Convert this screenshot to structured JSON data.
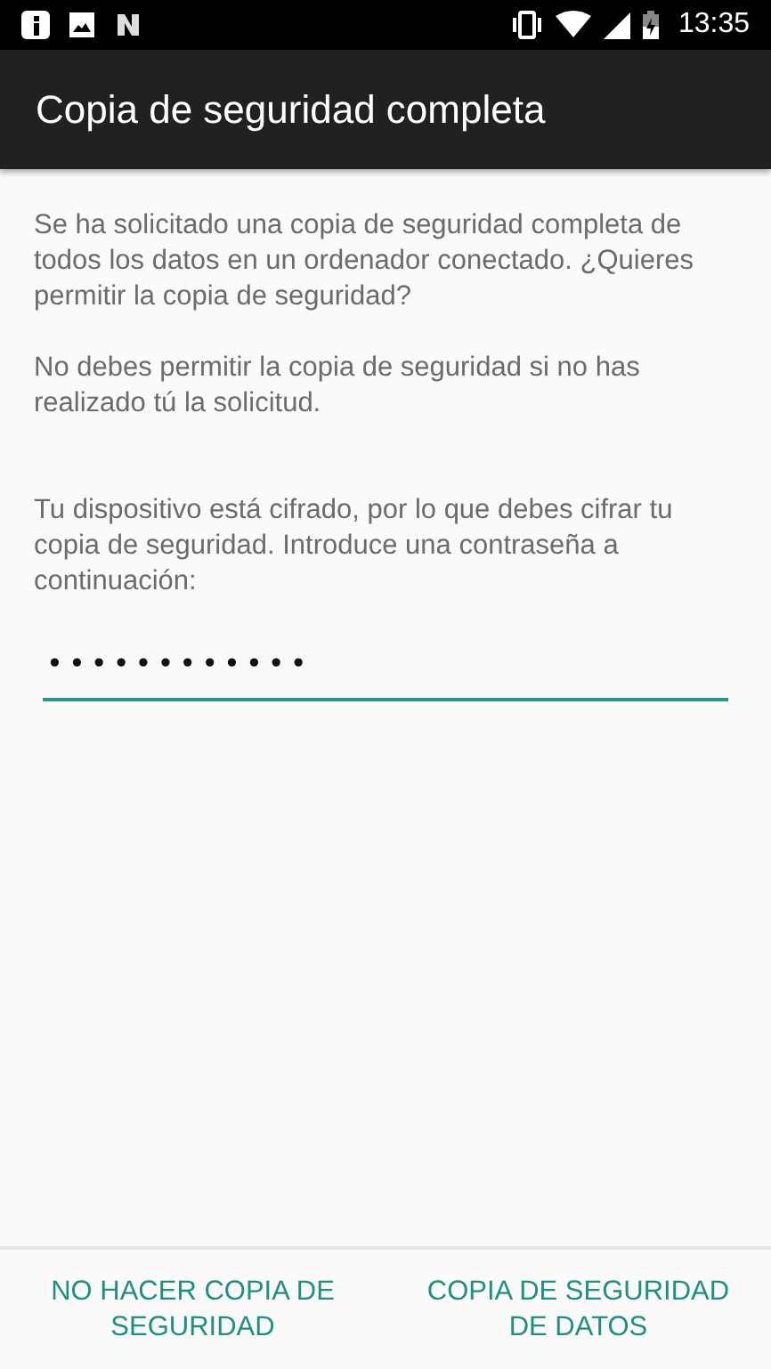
{
  "status_bar": {
    "time": "13:35"
  },
  "app_bar": {
    "title": "Copia de seguridad completa"
  },
  "paragraphs": [
    "Se ha solicitado una copia de seguridad completa de todos los datos en un ordenador conectado. ¿Quieres permitir la copia de seguridad?",
    "No debes permitir la copia de seguridad si no has realizado tú la solicitud.",
    "Tu dispositivo está cifrado, por lo que debes cifrar tu copia de seguridad. Introduce una contraseña a continuación:"
  ],
  "password_field": {
    "value": "••••••••••••",
    "focused": true
  },
  "buttons": [
    "NO HACER COPIA DE SEGURIDAD",
    "COPIA DE SEGURIDAD DE DATOS"
  ]
}
